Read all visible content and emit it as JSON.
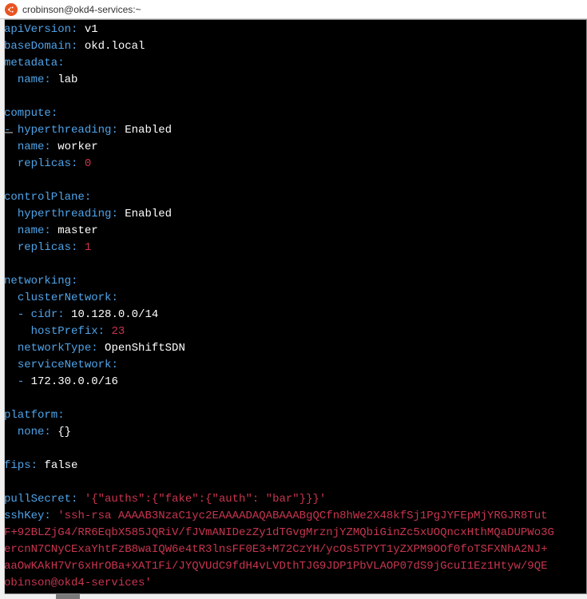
{
  "window": {
    "title": "crobinson@okd4-services:~"
  },
  "yaml": {
    "apiVersion": {
      "key": "apiVersion",
      "value": "v1"
    },
    "baseDomain": {
      "key": "baseDomain",
      "value": "okd.local"
    },
    "metadata": {
      "key": "metadata"
    },
    "metadata_name": {
      "key": "name",
      "value": "lab"
    },
    "compute": {
      "key": "compute"
    },
    "compute_ht": {
      "key": "hyperthreading",
      "value": "Enabled"
    },
    "compute_name": {
      "key": "name",
      "value": "worker"
    },
    "compute_replicas": {
      "key": "replicas",
      "value": "0"
    },
    "controlPlane": {
      "key": "controlPlane"
    },
    "cp_ht": {
      "key": "hyperthreading",
      "value": "Enabled"
    },
    "cp_name": {
      "key": "name",
      "value": "master"
    },
    "cp_replicas": {
      "key": "replicas",
      "value": "1"
    },
    "networking": {
      "key": "networking"
    },
    "clusterNetwork": {
      "key": "clusterNetwork"
    },
    "cn_cidr": {
      "key": "cidr",
      "value": "10.128.0.0/14"
    },
    "cn_hostPrefix": {
      "key": "hostPrefix",
      "value": "23"
    },
    "networkType": {
      "key": "networkType",
      "value": "OpenShiftSDN"
    },
    "serviceNetwork": {
      "key": "serviceNetwork"
    },
    "sn_entry": {
      "value": "172.30.0.0/16"
    },
    "platform": {
      "key": "platform"
    },
    "platform_none": {
      "key": "none",
      "value": "{}"
    },
    "fips": {
      "key": "fips",
      "value": "false"
    },
    "pullSecret": {
      "key": "pullSecret",
      "value": "'{\"auths\":{\"fake\":{\"auth\": \"bar\"}}}'"
    },
    "sshKey": {
      "key": "sshKey",
      "line1": "'ssh-rsa AAAAB3NzaC1yc2EAAAADAQABAAABgQCfn8hWe2X48kfSj1PgJYFEpMjYRGJR8Tut",
      "line2": "F+92BLZjG4/RR6EqbX585JQRiV/fJVmANIDezZy1dTGvgMrznjYZMQbiGinZc5xUOQncxHthMQaDUPWo3G",
      "line3": "ercnN7CNyCExaYhtFzB8waIQW6e4tR3lnsFF0E3+M72CzYH/ycOs5TPYT1yZXPM9OOf0foTSFXNhA2NJ+",
      "line4": "aaOwKAkH7Vr6xHrOBa+XAT1Fi/JYQVUdC9fdH4vLVDthTJG9JDP1PbVLAOP07dS9jGcuI1Ez1Htyw/9QE",
      "line5": "obinson@okd4-services'"
    }
  }
}
